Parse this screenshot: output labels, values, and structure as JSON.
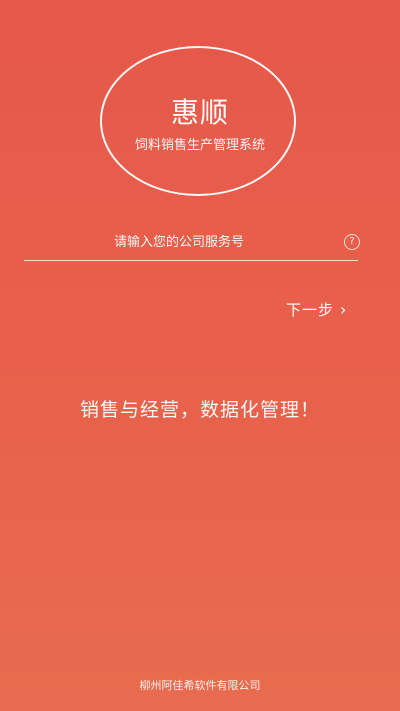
{
  "colors": {
    "background_top": "#e6584a",
    "background_bottom": "#e86c4f",
    "foreground": "#ffffff"
  },
  "brand": {
    "title": "惠顺",
    "subtitle": "饲料销售生产管理系统"
  },
  "service_input": {
    "placeholder": "请输入您的公司服务号",
    "value": "",
    "help_icon": "question-circle-icon"
  },
  "next": {
    "label": "下一步",
    "icon": "chevron-right-icon"
  },
  "slogan": "销售与经营，数据化管理！",
  "footer": {
    "company": "柳州阿佳希软件有限公司"
  }
}
